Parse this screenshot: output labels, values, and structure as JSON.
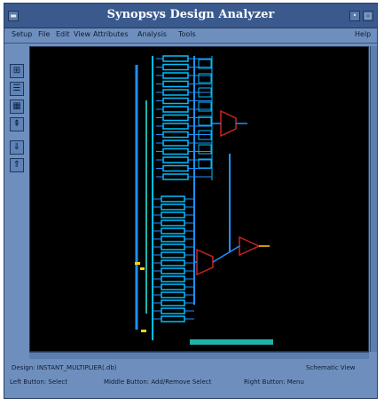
{
  "window": {
    "title": "Synopsys Design Analyzer"
  },
  "menubar": {
    "items": [
      "Setup",
      "File",
      "Edit",
      "View",
      "Attributes",
      "Analysis",
      "Tools"
    ],
    "help_label": "Help"
  },
  "toolbar": {
    "tools": [
      {
        "icon": "design-icon",
        "glyph": "⊞"
      },
      {
        "icon": "symbol-icon",
        "glyph": "☰"
      },
      {
        "icon": "schematic-icon",
        "glyph": "▦"
      },
      {
        "icon": "hierarchy-icon",
        "glyph": "⇞"
      },
      {
        "icon": "down-level-icon",
        "glyph": "⇓"
      },
      {
        "icon": "up-level-icon",
        "glyph": "⇑"
      }
    ]
  },
  "status": {
    "design_info": "Design: INSTANT_MULTIPLIER(.db)",
    "view_mode": "Schematic View",
    "mouse_left": "Left Button: Select",
    "mouse_middle": "Middle Button: Add/Remove Select",
    "mouse_right": "Right Button: Menu"
  },
  "colors": {
    "window_frame": "#6e8fbd",
    "titlebar": "#3a5a8e",
    "canvas": "#000000",
    "wire": "#1e90ff",
    "cell": "#00bfff",
    "bus": "#20b2aa",
    "mux": "#cc2222",
    "highlight": "#ffd700"
  }
}
